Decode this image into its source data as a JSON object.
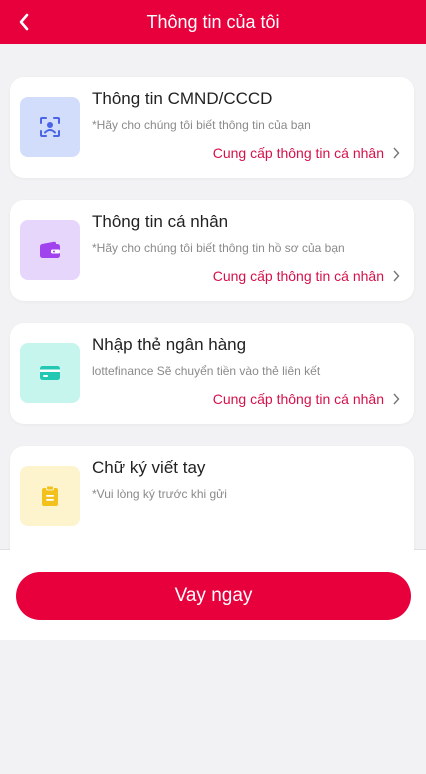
{
  "header": {
    "title": "Thông tin của tôi"
  },
  "cards": [
    {
      "title": "Thông tin CMND/CCCD",
      "desc": "*Hãy cho chúng tôi biết thông tin của bạn",
      "action": "Cung cấp thông tin cá nhân",
      "icon": "id-card-icon",
      "icon_bg": "#d2dcfb",
      "icon_color": "#4b63e6"
    },
    {
      "title": "Thông tin cá nhân",
      "desc": "*Hãy cho chúng tôi biết thông tin hồ sơ của bạn",
      "action": "Cung cấp thông tin cá nhân",
      "icon": "wallet-icon",
      "icon_bg": "#e6d6fc",
      "icon_color": "#a142ef"
    },
    {
      "title": "Nhập thẻ ngân hàng",
      "desc": "lottefinance Sẽ chuyển tiền vào thẻ liên kết",
      "action": "Cung cấp thông tin cá nhân",
      "icon": "bank-card-icon",
      "icon_bg": "#c6f5ee",
      "icon_color": "#23c8b3"
    },
    {
      "title": "Chữ ký viết tay",
      "desc": "*Vui lòng ký trước khi gửi",
      "icon": "clipboard-icon",
      "icon_bg": "#fdf3cd",
      "icon_color": "#f3c11c"
    }
  ],
  "primary_button": {
    "label": "Vay ngay"
  },
  "colors": {
    "brand": "#e8003d",
    "action_text": "#d6104a",
    "background": "#f2f2f4"
  }
}
